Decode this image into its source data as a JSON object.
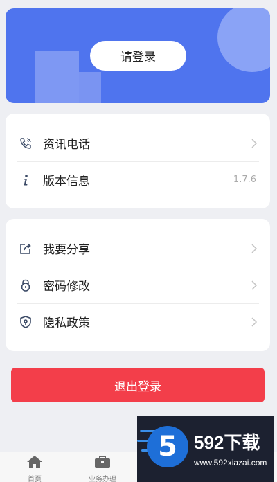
{
  "header": {
    "login_label": "请登录"
  },
  "card1": {
    "items": [
      {
        "label": "资讯电话",
        "icon": "phone-icon"
      },
      {
        "label": "版本信息",
        "icon": "info-icon",
        "value": "1.7.6"
      }
    ]
  },
  "card2": {
    "items": [
      {
        "label": "我要分享",
        "icon": "share-icon"
      },
      {
        "label": "密码修改",
        "icon": "lock-icon"
      },
      {
        "label": "隐私政策",
        "icon": "shield-icon"
      }
    ]
  },
  "logout_label": "退出登录",
  "tabbar": {
    "tabs": [
      {
        "label": "首页",
        "icon": "home-icon"
      },
      {
        "label": "业务办理",
        "icon": "briefcase-icon"
      }
    ]
  },
  "watermark": {
    "title": "592下载",
    "url": "www.592xiazai.com",
    "logo_char": "5"
  },
  "colors": {
    "banner": "#4f74ee",
    "logout": "#f33e4a",
    "background": "#eeeff3"
  }
}
